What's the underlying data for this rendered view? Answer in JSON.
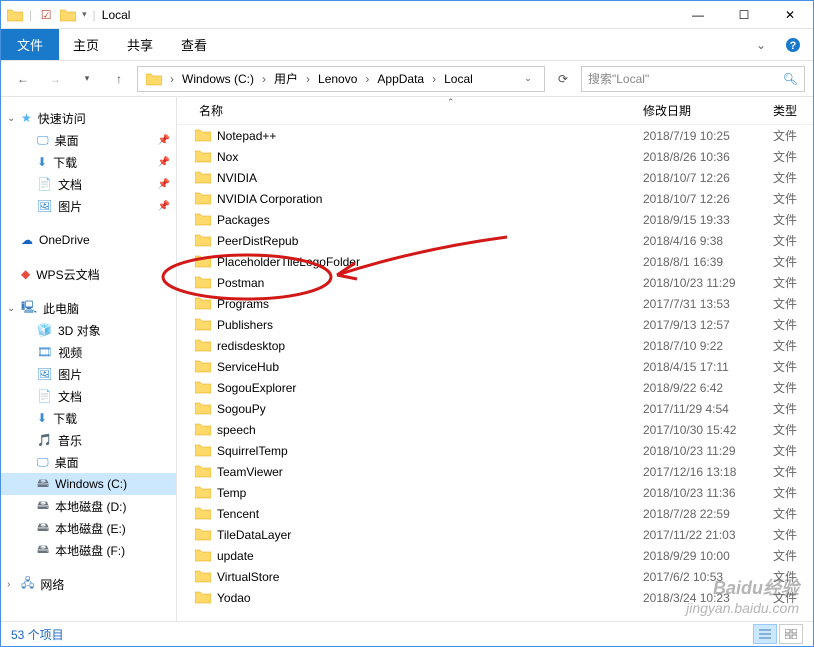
{
  "window": {
    "title": "Local"
  },
  "ribbon": {
    "file": "文件",
    "tabs": [
      "主页",
      "共享",
      "查看"
    ]
  },
  "breadcrumb": {
    "parts": [
      "Windows (C:)",
      "用户",
      "Lenovo",
      "AppData",
      "Local"
    ]
  },
  "search": {
    "placeholder": "搜索\"Local\""
  },
  "nav_pane": {
    "quick_access": "快速访问",
    "quick_items": [
      {
        "label": "桌面",
        "pinned": true,
        "icon": "desktop"
      },
      {
        "label": "下载",
        "pinned": true,
        "icon": "downloads"
      },
      {
        "label": "文档",
        "pinned": true,
        "icon": "documents"
      },
      {
        "label": "图片",
        "pinned": true,
        "icon": "pictures"
      }
    ],
    "onedrive": "OneDrive",
    "wps": "WPS云文档",
    "this_pc": "此电脑",
    "pc_items": [
      {
        "label": "3D 对象",
        "icon": "3d"
      },
      {
        "label": "视频",
        "icon": "videos"
      },
      {
        "label": "图片",
        "icon": "pictures"
      },
      {
        "label": "文档",
        "icon": "documents"
      },
      {
        "label": "下载",
        "icon": "downloads"
      },
      {
        "label": "音乐",
        "icon": "music"
      },
      {
        "label": "桌面",
        "icon": "desktop"
      },
      {
        "label": "Windows (C:)",
        "icon": "drive",
        "selected": true
      },
      {
        "label": "本地磁盘 (D:)",
        "icon": "drive"
      },
      {
        "label": "本地磁盘 (E:)",
        "icon": "drive"
      },
      {
        "label": "本地磁盘 (F:)",
        "icon": "drive"
      }
    ],
    "network": "网络"
  },
  "columns": {
    "name": "名称",
    "date": "修改日期",
    "type": "类型"
  },
  "files": [
    {
      "name": "Notepad++",
      "date": "2018/7/19 10:25",
      "type": "文件"
    },
    {
      "name": "Nox",
      "date": "2018/8/26 10:36",
      "type": "文件"
    },
    {
      "name": "NVIDIA",
      "date": "2018/10/7 12:26",
      "type": "文件"
    },
    {
      "name": "NVIDIA Corporation",
      "date": "2018/10/7 12:26",
      "type": "文件"
    },
    {
      "name": "Packages",
      "date": "2018/9/15 19:33",
      "type": "文件"
    },
    {
      "name": "PeerDistRepub",
      "date": "2018/4/16 9:38",
      "type": "文件"
    },
    {
      "name": "PlaceholderTileLogoFolder",
      "date": "2018/8/1 16:39",
      "type": "文件"
    },
    {
      "name": "Postman",
      "date": "2018/10/23 11:29",
      "type": "文件"
    },
    {
      "name": "Programs",
      "date": "2017/7/31 13:53",
      "type": "文件"
    },
    {
      "name": "Publishers",
      "date": "2017/9/13 12:57",
      "type": "文件"
    },
    {
      "name": "redisdesktop",
      "date": "2018/7/10 9:22",
      "type": "文件"
    },
    {
      "name": "ServiceHub",
      "date": "2018/4/15 17:11",
      "type": "文件"
    },
    {
      "name": "SogouExplorer",
      "date": "2018/9/22 6:42",
      "type": "文件"
    },
    {
      "name": "SogouPy",
      "date": "2017/11/29 4:54",
      "type": "文件"
    },
    {
      "name": "speech",
      "date": "2017/10/30 15:42",
      "type": "文件"
    },
    {
      "name": "SquirrelTemp",
      "date": "2018/10/23 11:29",
      "type": "文件"
    },
    {
      "name": "TeamViewer",
      "date": "2017/12/16 13:18",
      "type": "文件"
    },
    {
      "name": "Temp",
      "date": "2018/10/23 11:36",
      "type": "文件"
    },
    {
      "name": "Tencent",
      "date": "2018/7/28 22:59",
      "type": "文件"
    },
    {
      "name": "TileDataLayer",
      "date": "2017/11/22 21:03",
      "type": "文件"
    },
    {
      "name": "update",
      "date": "2018/9/29 10:00",
      "type": "文件"
    },
    {
      "name": "VirtualStore",
      "date": "2017/6/2 10:53",
      "type": "文件"
    },
    {
      "name": "Yodao",
      "date": "2018/3/24 10:23",
      "type": "文件"
    }
  ],
  "status": {
    "count": "53 个项目"
  },
  "watermark": {
    "brand": "Baidu经验",
    "url": "jingyan.baidu.com"
  }
}
